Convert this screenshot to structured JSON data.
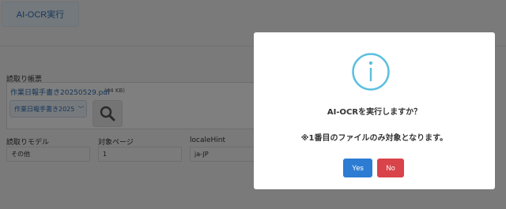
{
  "toolbar": {
    "ocr_button_label": "AI-OCR実行"
  },
  "form": {
    "form_label": "読取り帳票",
    "file_name": "作業日報手書き20250529.pdf",
    "file_size": "(44 KB)",
    "selected_template": "作業日報手書き2025",
    "model_label": "読取りモデル",
    "model_value": "その他",
    "pages_label": "対象ページ",
    "pages_value": "1",
    "locale_label": "localeHint",
    "locale_value": "ja-JP"
  },
  "dialog": {
    "icon": "info-icon",
    "title": "AI-OCRを実行しますか？",
    "message": "※1番目のファイルのみ対象となります。",
    "yes_label": "Yes",
    "no_label": "No"
  },
  "colors": {
    "accent": "#2d7cd3",
    "danger": "#d9434a",
    "info": "#5bc0de"
  }
}
